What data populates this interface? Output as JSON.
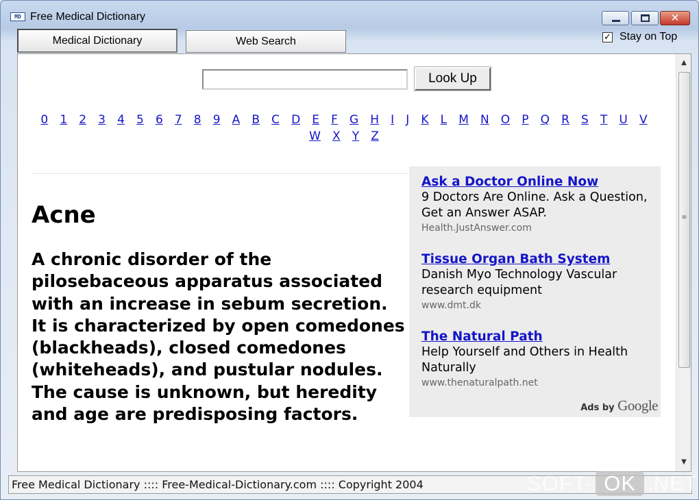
{
  "window": {
    "title": "Free Medical Dictionary",
    "icon_label": "MD"
  },
  "tabs": [
    {
      "label": "Medical Dictionary",
      "active": true
    },
    {
      "label": "Web Search",
      "active": false
    }
  ],
  "stay_on_top": {
    "label": "Stay on Top",
    "checked": true
  },
  "search": {
    "value": "",
    "placeholder": "",
    "button_label": "Look Up"
  },
  "alphabet": [
    "0",
    "1",
    "2",
    "3",
    "4",
    "5",
    "6",
    "7",
    "8",
    "9",
    "A",
    "B",
    "C",
    "D",
    "E",
    "F",
    "G",
    "H",
    "I",
    "J",
    "K",
    "L",
    "M",
    "N",
    "O",
    "P",
    "Q",
    "R",
    "S",
    "T",
    "U",
    "V",
    "W",
    "X",
    "Y",
    "Z"
  ],
  "entry": {
    "term": "Acne",
    "definition": "A chronic disorder of the pilosebaceous apparatus associated with an increase in sebum secretion. It is characterized by open comedones (blackheads), closed comedones (whiteheads), and pustular nodules. The cause is unknown, but heredity and age are predisposing factors."
  },
  "ads": {
    "items": [
      {
        "title": "Ask a Doctor Online Now",
        "text": "9 Doctors Are Online. Ask a Question, Get an Answer ASAP.",
        "url": "Health.JustAnswer.com"
      },
      {
        "title": "Tissue Organ Bath System",
        "text": "Danish Myo Technology Vascular research equipment",
        "url": "www.dmt.dk"
      },
      {
        "title": "The Natural Path",
        "text": "Help Yourself and Others in Health Naturally",
        "url": "www.thenaturalpath.net"
      }
    ],
    "ads_by": "Ads by",
    "provider": "Google"
  },
  "status": "Free Medical Dictionary :::: Free-Medical-Dictionary.com :::: Copyright 2004",
  "watermark": {
    "left": "SOFT-",
    "box": "OK",
    "right": ".NET"
  },
  "colors": {
    "link": "#1515c8",
    "ad_background": "#ececec",
    "close_button": "#c3392b"
  }
}
